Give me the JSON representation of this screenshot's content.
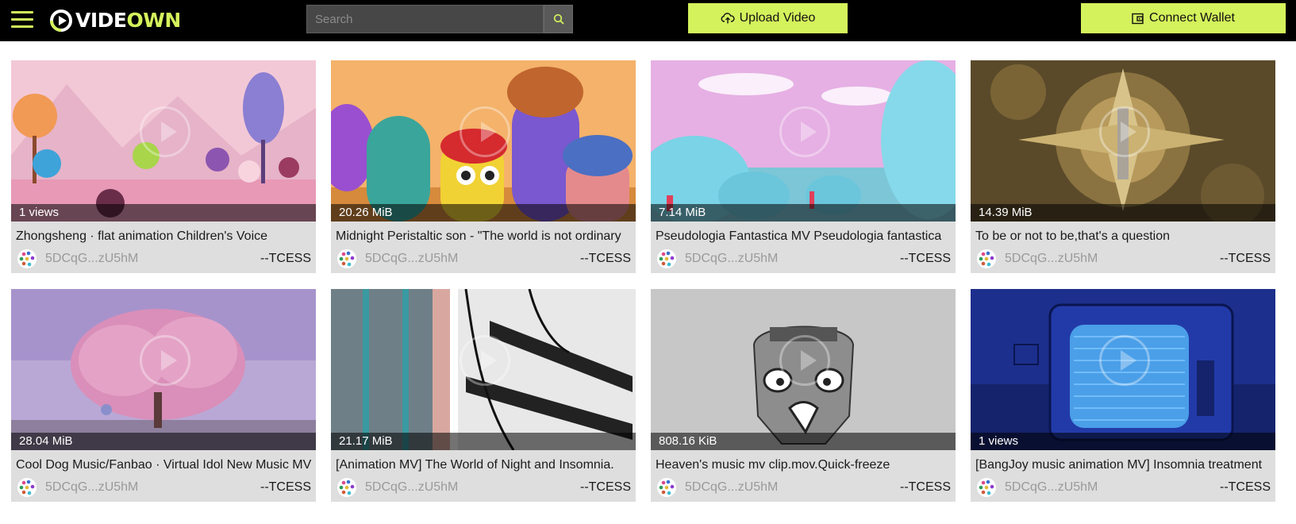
{
  "header": {
    "logo_part1": "VIDE",
    "logo_part2": "OWN",
    "search_placeholder": "Search",
    "upload_label": "Upload Video",
    "wallet_label": "Connect Wallet"
  },
  "colors": {
    "accent": "#d4f25c",
    "topbar": "#000000",
    "card_bg": "#dedede"
  },
  "videos": [
    {
      "badge": "1 views",
      "title": "Zhongsheng · flat animation Children's Voice",
      "address": "5DCqG...zU5hM",
      "author": "--TCESS"
    },
    {
      "badge": "20.26 MiB",
      "title": "Midnight Peristaltic son - \"The world is not ordinary",
      "address": "5DCqG...zU5hM",
      "author": "--TCESS"
    },
    {
      "badge": "7.14 MiB",
      "title": "Pseudologia Fantastica MV Pseudologia fantastica",
      "address": "5DCqG...zU5hM",
      "author": "--TCESS"
    },
    {
      "badge": "14.39 MiB",
      "title": "To be or not to be,that's a question",
      "address": "5DCqG...zU5hM",
      "author": "--TCESS"
    },
    {
      "badge": "28.04 MiB",
      "title": "Cool Dog Music/Fanbao · Virtual Idol New Music MV",
      "address": "5DCqG...zU5hM",
      "author": "--TCESS"
    },
    {
      "badge": "21.17 MiB",
      "title": "[Animation MV] The World of Night and Insomnia.",
      "address": "5DCqG...zU5hM",
      "author": "--TCESS"
    },
    {
      "badge": "808.16 KiB",
      "title": "Heaven's music mv clip.mov.Quick-freeze",
      "address": "5DCqG...zU5hM",
      "author": "--TCESS"
    },
    {
      "badge": "1 views",
      "title": "[BangJoy music animation MV] Insomnia treatment",
      "address": "5DCqG...zU5hM",
      "author": "--TCESS"
    }
  ]
}
